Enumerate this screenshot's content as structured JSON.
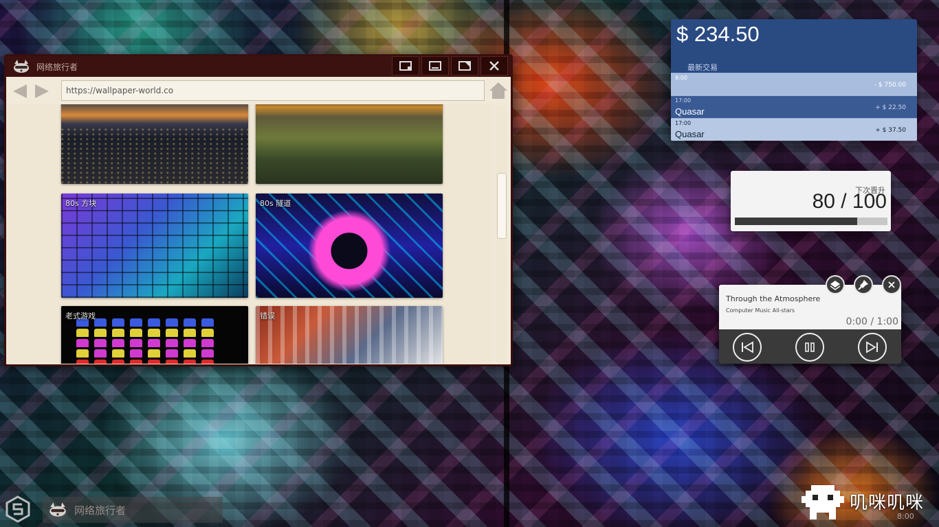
{
  "browser": {
    "title": "网络旅行者",
    "url": "https://wallpaper-world.co",
    "tiles": [
      {
        "label": ""
      },
      {
        "label": ""
      },
      {
        "label": "80s 方块"
      },
      {
        "label": "80s 隧道"
      },
      {
        "label": "老式游戏"
      },
      {
        "label": "错误"
      }
    ]
  },
  "wallet": {
    "balance": "$  234.50",
    "recent_label": "最新交易",
    "transactions": [
      {
        "time": "8:00",
        "name": "",
        "amount": "- $  750.00"
      },
      {
        "time": "17:00",
        "name": "Quasar",
        "amount": "+ $  22.50"
      },
      {
        "time": "17:00",
        "name": "Quasar",
        "amount": "+ $  37.50"
      }
    ]
  },
  "level": {
    "label": "下次晋升",
    "value": "80 / 100",
    "progress": 0.8
  },
  "player": {
    "title": "Through the Atmosphere",
    "artist": "Computer Music All-stars",
    "time": "0:00 / 1:00"
  },
  "taskbar": {
    "item_label": "网络旅行者",
    "mascot_text": "叽咪叽咪",
    "clock": "8:00"
  },
  "colors": {
    "titlebar": "#3b1210",
    "wallet_header": "#2a4a82",
    "player_controls": "#3a3a3a"
  }
}
